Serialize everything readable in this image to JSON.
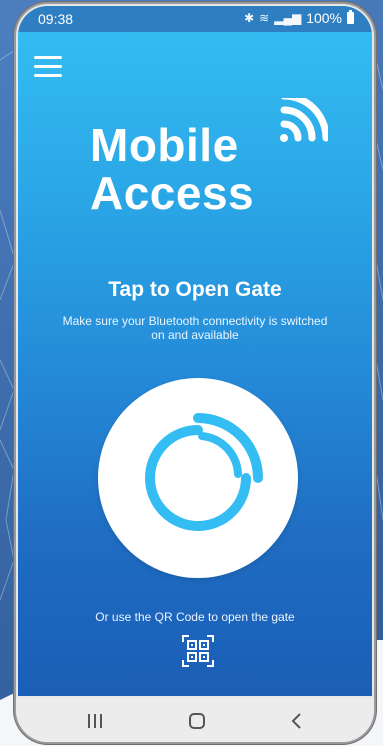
{
  "status_bar": {
    "time": "09:38",
    "battery": "100%",
    "bluetooth_icon": "bluetooth-icon",
    "wifi_icon": "wifi-icon",
    "signal_icon": "signal-icon"
  },
  "header": {
    "menu_icon": "hamburger-menu-icon"
  },
  "brand": {
    "line1": "Mobile",
    "line2": "Access",
    "icon": "wireless-signal-icon"
  },
  "main": {
    "title": "Tap to Open Gate",
    "subtitle": "Make sure your Bluetooth connectivity is switched on and available",
    "open_button_icon": "circular-arc-icon",
    "qr_prompt": "Or use the QR Code to open the gate",
    "qr_icon": "qr-code-icon"
  },
  "navigation": {
    "recents_icon": "recent-apps-icon",
    "home_icon": "home-icon",
    "back_icon": "back-icon"
  },
  "colors": {
    "accent": "#2aa6e6",
    "accent_light": "#35bff3",
    "accent_dark": "#1b5eb6",
    "button_arc": "#34bdf2",
    "navbar": "#ececec"
  }
}
